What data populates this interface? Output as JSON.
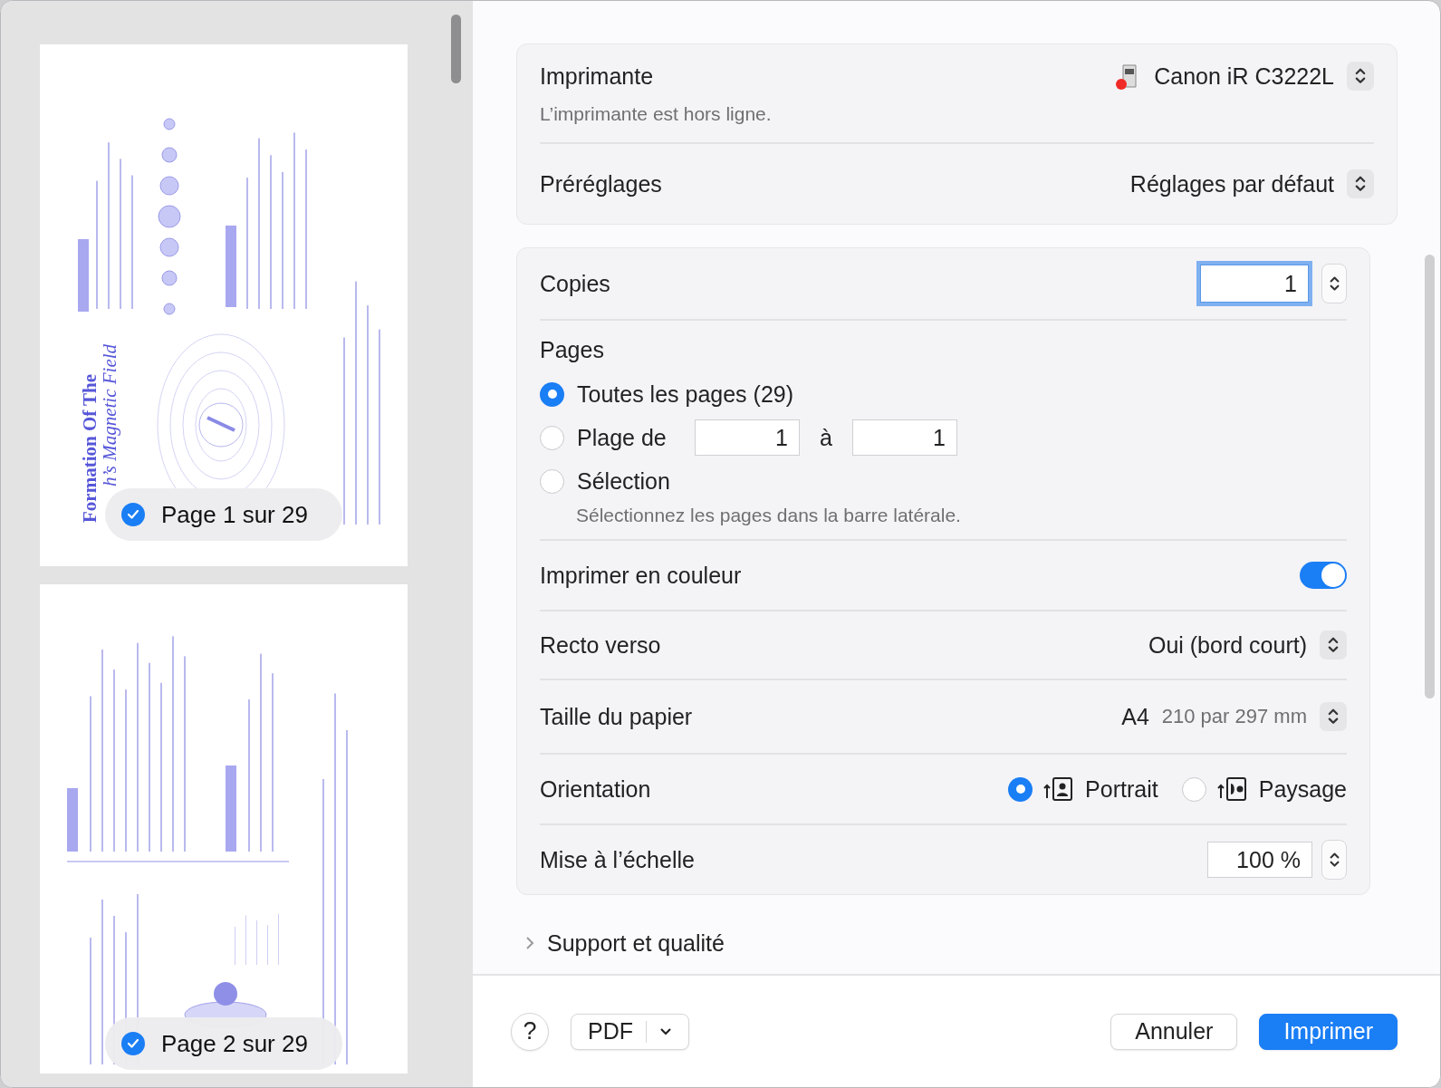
{
  "sidebar": {
    "pages": [
      {
        "kind": "cover",
        "label": "Page 1 sur 29",
        "selected": true,
        "title_lines": [
          "Formation Of The",
          "h’s Magnetic Field"
        ]
      },
      {
        "kind": "text",
        "label": "Page 2 sur 29",
        "selected": true
      }
    ]
  },
  "printer": {
    "label": "Imprimante",
    "value": "Canon iR C3222L",
    "status": "L’imprimante est hors ligne.",
    "offline": true
  },
  "presets": {
    "label": "Préréglages",
    "value": "Réglages par défaut"
  },
  "copies": {
    "label": "Copies",
    "value": "1"
  },
  "pages": {
    "label": "Pages",
    "options": [
      {
        "kind": "all",
        "label": "Toutes les pages (29)",
        "selected": true
      },
      {
        "kind": "range",
        "label": "Plage de",
        "from": "1",
        "to_label": "à",
        "to": "1",
        "selected": false
      },
      {
        "kind": "selection",
        "label": "Sélection",
        "hint": "Sélectionnez les pages dans la barre latérale.",
        "selected": false
      }
    ]
  },
  "color": {
    "label": "Imprimer en couleur",
    "on": true
  },
  "duplex": {
    "label": "Recto verso",
    "value": "Oui (bord court)"
  },
  "paper": {
    "label": "Taille du papier",
    "size": "A4",
    "dimensions": "210 par 297 mm"
  },
  "orientation": {
    "label": "Orientation",
    "options": [
      {
        "kind": "portrait",
        "label": "Portrait",
        "selected": true
      },
      {
        "kind": "landscape",
        "label": "Paysage",
        "selected": false
      }
    ]
  },
  "scale": {
    "label": "Mise à l’échelle",
    "value": "100 %"
  },
  "disclosure": {
    "label": "Support et qualité",
    "expanded": false
  },
  "footer": {
    "help": "?",
    "pdf": "PDF",
    "cancel": "Annuler",
    "print": "Imprimer"
  }
}
